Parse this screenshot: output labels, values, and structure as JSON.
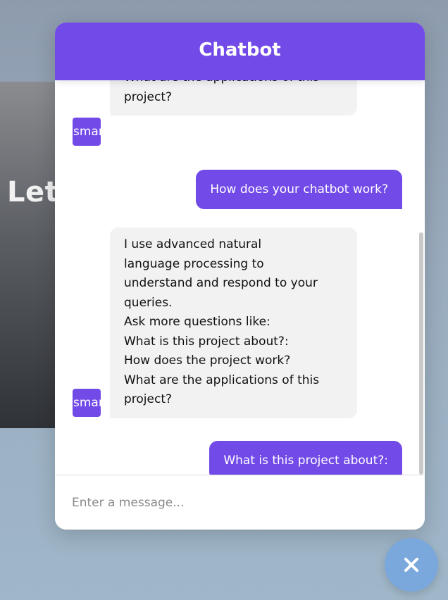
{
  "background": {
    "hero_text": "Let"
  },
  "chatbot": {
    "title": "Chatbot",
    "accent_color": "#724ae8",
    "avatar_label": "smart_toy",
    "messages": [
      {
        "sender": "bot",
        "lines": [
          "What are the applications of this",
          "project?"
        ]
      },
      {
        "sender": "user",
        "text": "How does your chatbot work?"
      },
      {
        "sender": "bot",
        "lines": [
          "I use advanced natural",
          "language processing to",
          "understand and respond to your",
          "queries.",
          "Ask more questions like:",
          "What is this project about?:",
          "How does the project work?",
          "What are the applications of this",
          "project?"
        ]
      },
      {
        "sender": "user",
        "text": "What is this project about?:"
      }
    ],
    "input": {
      "placeholder": "Enter a message..."
    },
    "toggle_icon": "close-icon"
  }
}
